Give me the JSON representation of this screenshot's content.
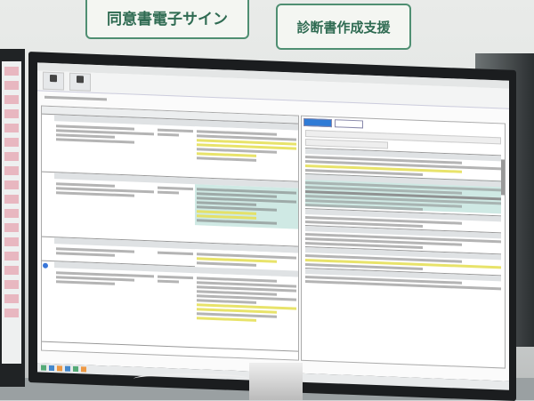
{
  "signs": {
    "left": "同意書電子サイン",
    "right": "診断書作成支援"
  },
  "colors": {
    "sign_border": "#4f8f72",
    "highlight_yellow": "#e6e05a",
    "highlight_teal": "#cfe9e4",
    "active_tab": "#2f7bd6"
  },
  "left_pane": {
    "block_count": 4
  },
  "right_pane": {
    "block_count": 6
  }
}
